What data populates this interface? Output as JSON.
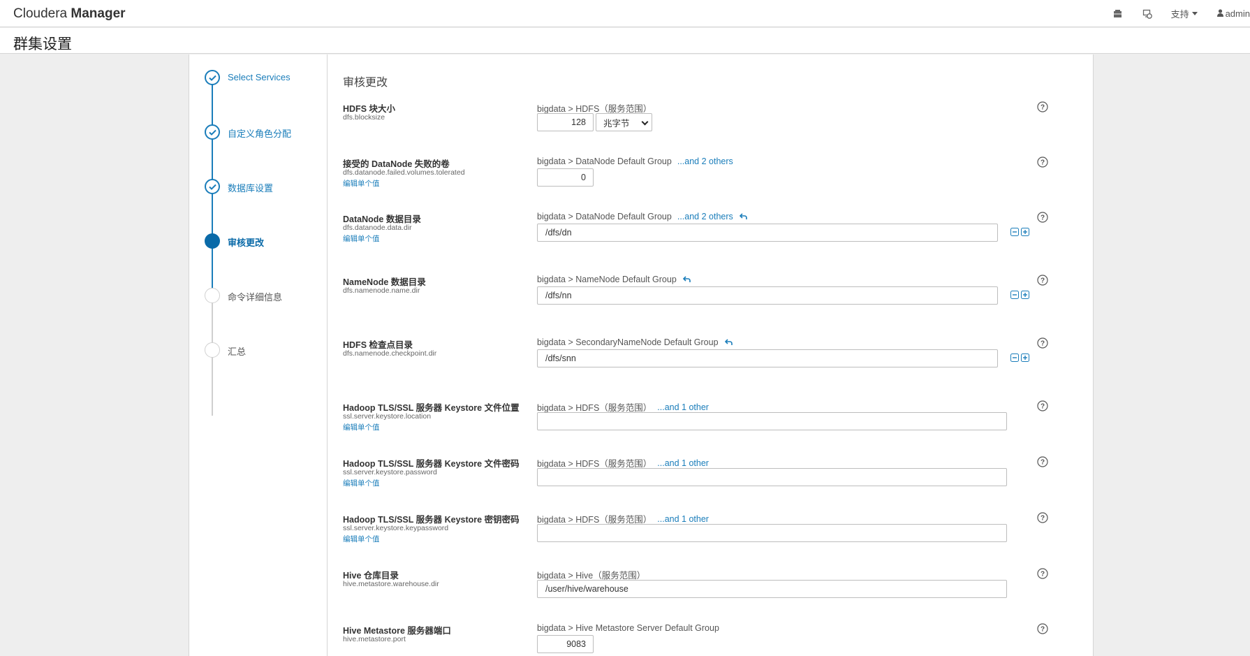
{
  "header": {
    "brand_regular": "Cloudera ",
    "brand_bold": "Manager",
    "support_label": "支持",
    "user_label": "admin"
  },
  "page": {
    "title": "群集设置"
  },
  "wizard": {
    "steps": [
      {
        "label": "Select Services",
        "state": "done"
      },
      {
        "label": "自定义角色分配",
        "state": "done"
      },
      {
        "label": "数据库设置",
        "state": "done"
      },
      {
        "label": "审核更改",
        "state": "active"
      },
      {
        "label": "命令详细信息",
        "state": "todo"
      },
      {
        "label": "汇总",
        "state": "todo"
      }
    ]
  },
  "main": {
    "section_title": "审核更改",
    "params": [
      {
        "name": "HDFS 块大小",
        "key": "dfs.blocksize",
        "edit": "",
        "scope": "bigdata > HDFS（服务范围）",
        "others": "",
        "value": "128",
        "unit": "兆字节"
      },
      {
        "name": "接受的 DataNode 失败的卷",
        "key": "dfs.datanode.failed.volumes.tolerated",
        "edit": "编辑单个值",
        "scope": "bigdata > DataNode Default Group",
        "others": "...and 2 others",
        "value": "0"
      },
      {
        "name": "DataNode 数据目录",
        "key": "dfs.datanode.data.dir",
        "edit": "编辑单个值",
        "scope": "bigdata > DataNode Default Group",
        "others": "...and 2 others",
        "value": "/dfs/dn"
      },
      {
        "name": "NameNode 数据目录",
        "key": "dfs.namenode.name.dir",
        "edit": "",
        "scope": "bigdata > NameNode Default Group",
        "others": "",
        "value": "/dfs/nn"
      },
      {
        "name": "HDFS 检查点目录",
        "key": "dfs.namenode.checkpoint.dir",
        "edit": "",
        "scope": "bigdata > SecondaryNameNode Default Group",
        "others": "",
        "value": "/dfs/snn"
      },
      {
        "name": "Hadoop TLS/SSL 服务器 Keystore 文件位置",
        "key": "ssl.server.keystore.location",
        "edit": "编辑单个值",
        "scope": "bigdata > HDFS（服务范围）",
        "others": "...and 1 other",
        "value": ""
      },
      {
        "name": "Hadoop TLS/SSL 服务器 Keystore 文件密码",
        "key": "ssl.server.keystore.password",
        "edit": "编辑单个值",
        "scope": "bigdata > HDFS（服务范围）",
        "others": "...and 1 other",
        "value": ""
      },
      {
        "name": "Hadoop TLS/SSL 服务器 Keystore 密钥密码",
        "key": "ssl.server.keystore.keypassword",
        "edit": "编辑单个值",
        "scope": "bigdata > HDFS（服务范围）",
        "others": "...and 1 other",
        "value": ""
      },
      {
        "name": "Hive 仓库目录",
        "key": "hive.metastore.warehouse.dir",
        "edit": "",
        "scope": "bigdata > Hive（服务范围）",
        "others": "",
        "value": "/user/hive/warehouse"
      },
      {
        "name": "Hive Metastore 服务器端口",
        "key": "hive.metastore.port",
        "edit": "",
        "scope": "bigdata > Hive Metastore Server Default Group",
        "others": "",
        "value": "9083"
      }
    ]
  }
}
